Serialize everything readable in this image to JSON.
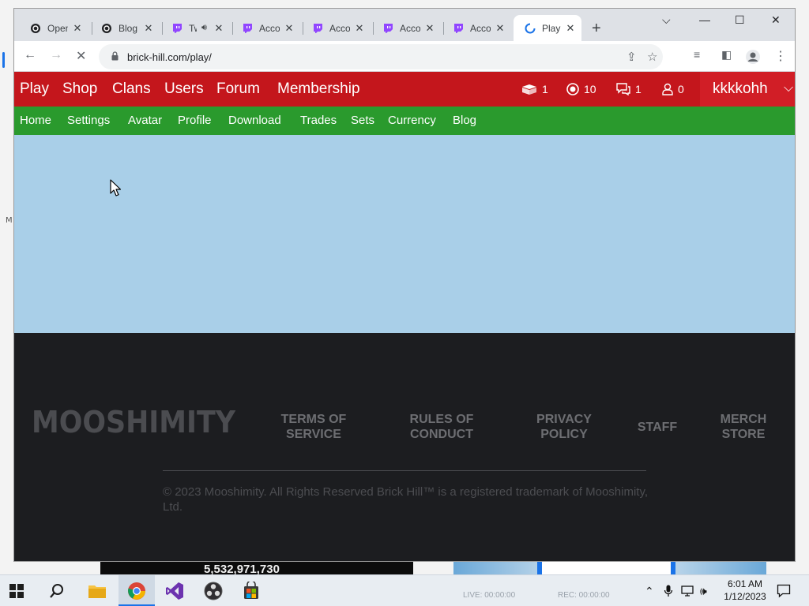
{
  "browser": {
    "tabs": [
      {
        "label": "OpenAI",
        "icon": "openai-icon",
        "active": false
      },
      {
        "label": "Blog",
        "icon": "openai-icon",
        "active": false
      },
      {
        "label": "Twitch",
        "icon": "twitch-icon",
        "active": false,
        "muted_audio": true
      },
      {
        "label": "Account",
        "icon": "twitch-icon",
        "active": false
      },
      {
        "label": "Account",
        "icon": "twitch-icon",
        "active": false
      },
      {
        "label": "Account",
        "icon": "twitch-icon",
        "active": false
      },
      {
        "label": "Account",
        "icon": "twitch-icon",
        "active": false
      },
      {
        "label": "Play",
        "icon": "brick-hill-icon",
        "active": true
      }
    ],
    "new_tab_symbol": "+",
    "url": "brick-hill.com/play/",
    "loading": true
  },
  "site": {
    "top_nav": [
      {
        "label": "Play"
      },
      {
        "label": "Shop"
      },
      {
        "label": "Clans"
      },
      {
        "label": "Users"
      },
      {
        "label": "Forum"
      },
      {
        "label": "Membership"
      }
    ],
    "stats": {
      "crate": "1",
      "bucks": "10",
      "messages": "1",
      "friend_requests": "0"
    },
    "username": "kkkkohh",
    "sub_nav": [
      {
        "label": "Home"
      },
      {
        "label": "Settings"
      },
      {
        "label": "Avatar"
      },
      {
        "label": "Profile"
      },
      {
        "label": "Download"
      },
      {
        "label": "Trades"
      },
      {
        "label": "Sets"
      },
      {
        "label": "Currency"
      },
      {
        "label": "Blog"
      }
    ],
    "footer": {
      "logo_text": "MOOSHIMITY",
      "links": [
        {
          "line1": "TERMS OF",
          "line2": "SERVICE"
        },
        {
          "line1": "RULES OF",
          "line2": "CONDUCT"
        },
        {
          "line1": "PRIVACY",
          "line2": "POLICY"
        },
        {
          "line1": "STAFF",
          "line2": ""
        },
        {
          "line1": "MERCH",
          "line2": "STORE"
        }
      ],
      "copyright": "© 2023 Mooshimity. All Rights Reserved Brick Hill™ is a registered trademark of Mooshimity, Ltd."
    }
  },
  "desktop": {
    "left_char": "M",
    "strip_number": "5,532,971,730",
    "ghost_live": "LIVE: 00:00:00",
    "ghost_rec": "REC: 00:00:00"
  },
  "taskbar": {
    "time": "6:01 AM",
    "date": "1/12/2023"
  },
  "colors": {
    "top_nav": "#c4161c",
    "sub_nav": "#2a9a2d",
    "content": "#a9cfe8",
    "footer": "#1c1d20"
  }
}
